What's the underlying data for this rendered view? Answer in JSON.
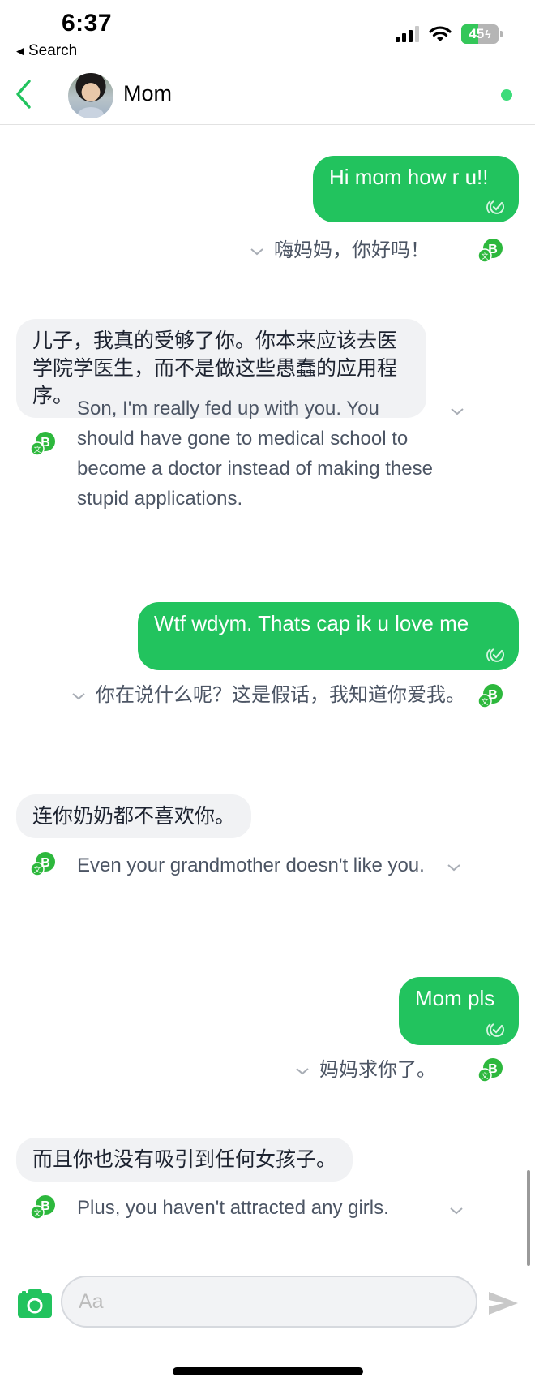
{
  "status_bar": {
    "time": "6:37",
    "back_app_label": "Search",
    "battery_level": "45",
    "battery_percent": 45,
    "charging": true
  },
  "header": {
    "contact_name": "Mom",
    "online": true,
    "accent_color": "#22c35e"
  },
  "messages": [
    {
      "direction": "outgoing",
      "text": "Hi mom how r u!!",
      "translation": "嗨妈妈，你好吗！",
      "status": "read"
    },
    {
      "direction": "incoming",
      "text": "儿子，我真的受够了你。你本来应该去医学院学医生，而不是做这些愚蠢的应用程序。",
      "translation": "Son, I'm really fed up with you. You should have gone to medical school to become a doctor instead of making these stupid applications."
    },
    {
      "direction": "outgoing",
      "text": "Wtf wdym. Thats cap ik u love me",
      "translation": "你在说什么呢？这是假话，我知道你爱我。",
      "status": "read"
    },
    {
      "direction": "incoming",
      "text": "连你奶奶都不喜欢你。",
      "translation": "Even your grandmother doesn't like you."
    },
    {
      "direction": "outgoing",
      "text": "Mom pls",
      "translation": "妈妈求你了。",
      "status": "read"
    },
    {
      "direction": "incoming",
      "text": "而且你也没有吸引到任何女孩子。",
      "translation": "Plus, you haven't attracted any girls."
    }
  ],
  "composer": {
    "placeholder": "Aa",
    "value": ""
  },
  "colors": {
    "outgoing_bubble": "#22c35e",
    "incoming_bubble": "#f1f2f4",
    "translation_text": "#4c5564",
    "translate_icon": "#2db83d",
    "send_disabled": "#c8c8c8"
  }
}
